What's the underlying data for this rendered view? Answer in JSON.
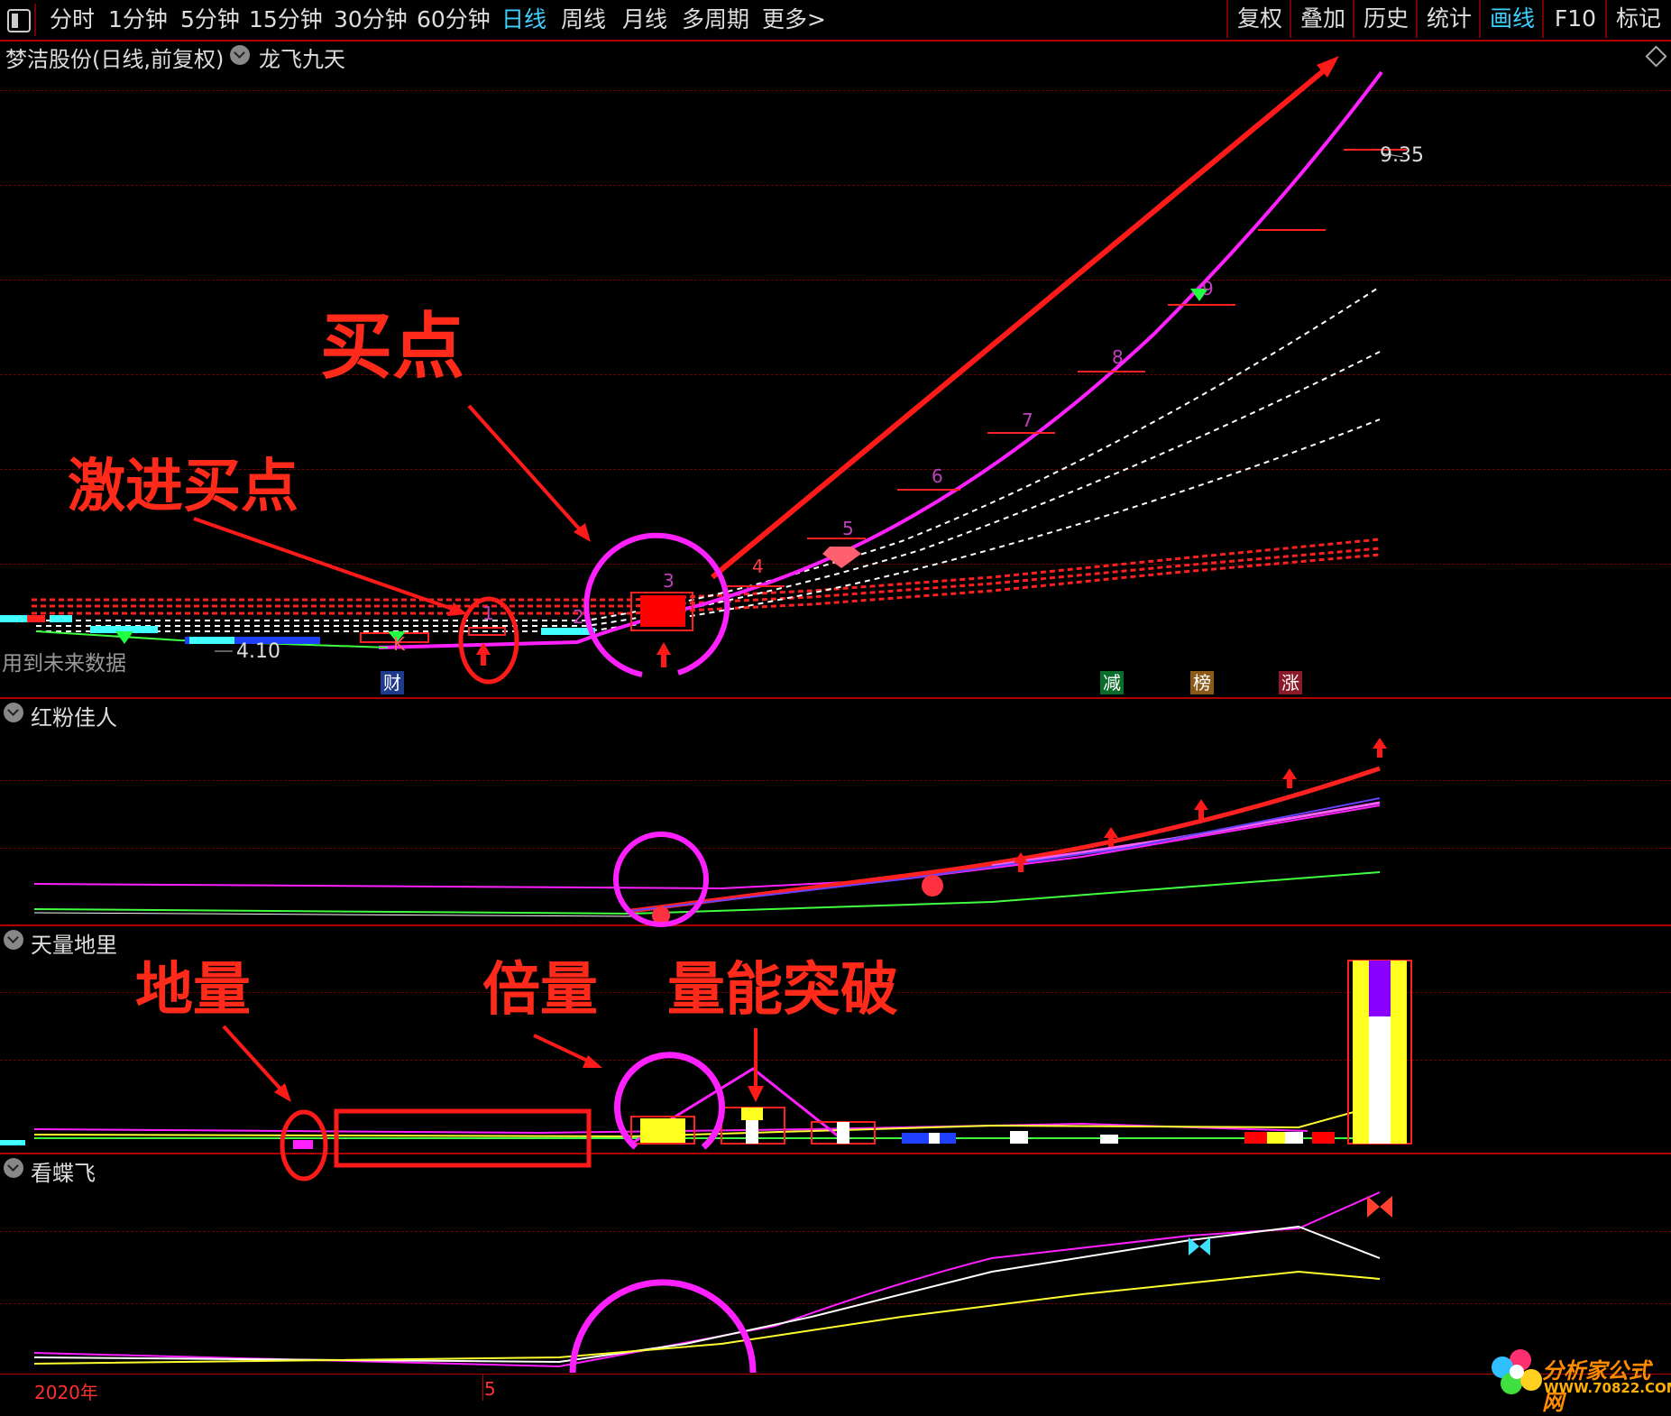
{
  "toolbar": {
    "left_items": [
      {
        "label": "分时",
        "active": false
      },
      {
        "label": "1分钟",
        "active": false
      },
      {
        "label": "5分钟",
        "active": false
      },
      {
        "label": "15分钟",
        "active": false
      },
      {
        "label": "30分钟",
        "active": false
      },
      {
        "label": "60分钟",
        "active": false
      },
      {
        "label": "日线",
        "active": true
      },
      {
        "label": "周线",
        "active": false
      },
      {
        "label": "月线",
        "active": false
      },
      {
        "label": "多周期",
        "active": false
      },
      {
        "label": "更多>",
        "active": false
      }
    ],
    "right_items": [
      {
        "label": "复权",
        "active": false
      },
      {
        "label": "叠加",
        "active": false
      },
      {
        "label": "历史",
        "active": false
      },
      {
        "label": "统计",
        "active": false
      },
      {
        "label": "画线",
        "active": true
      },
      {
        "label": "F10",
        "active": false
      },
      {
        "label": "标记",
        "active": false
      }
    ]
  },
  "main_panel": {
    "title": "梦洁股份(日线,前复权)",
    "indicator": "龙飞九天",
    "price_high": "9.35",
    "price_low": "4.10",
    "future_data_note": "用到未来数据",
    "k_marker": "K",
    "wave_numbers": [
      "1",
      "2",
      "3",
      "4",
      "5",
      "6",
      "7",
      "8",
      "9"
    ],
    "badges": [
      {
        "text": "财",
        "color": "#1e3a8a"
      },
      {
        "text": "减",
        "color": "#0a6b2a"
      },
      {
        "text": "榜",
        "color": "#8a5a1a"
      },
      {
        "text": "涨",
        "color": "#8a1a2a"
      }
    ]
  },
  "panels": [
    {
      "title": "红粉佳人"
    },
    {
      "title": "天量地里"
    },
    {
      "title": "看蝶飞"
    }
  ],
  "annotations": {
    "buy_point": "买点",
    "aggressive_buy": "激进买点",
    "ground_volume": "地量",
    "double_volume": "倍量",
    "volume_breakout": "量能突破"
  },
  "axis": {
    "year_label": "2020年",
    "month_label": "5"
  },
  "watermark": {
    "text": "分析家公式网",
    "url": "WWW.70822.COM"
  },
  "colors": {
    "accent_red": "#ff2a1a",
    "magenta": "#ff20ff",
    "active_blue": "#3fd0ff"
  }
}
